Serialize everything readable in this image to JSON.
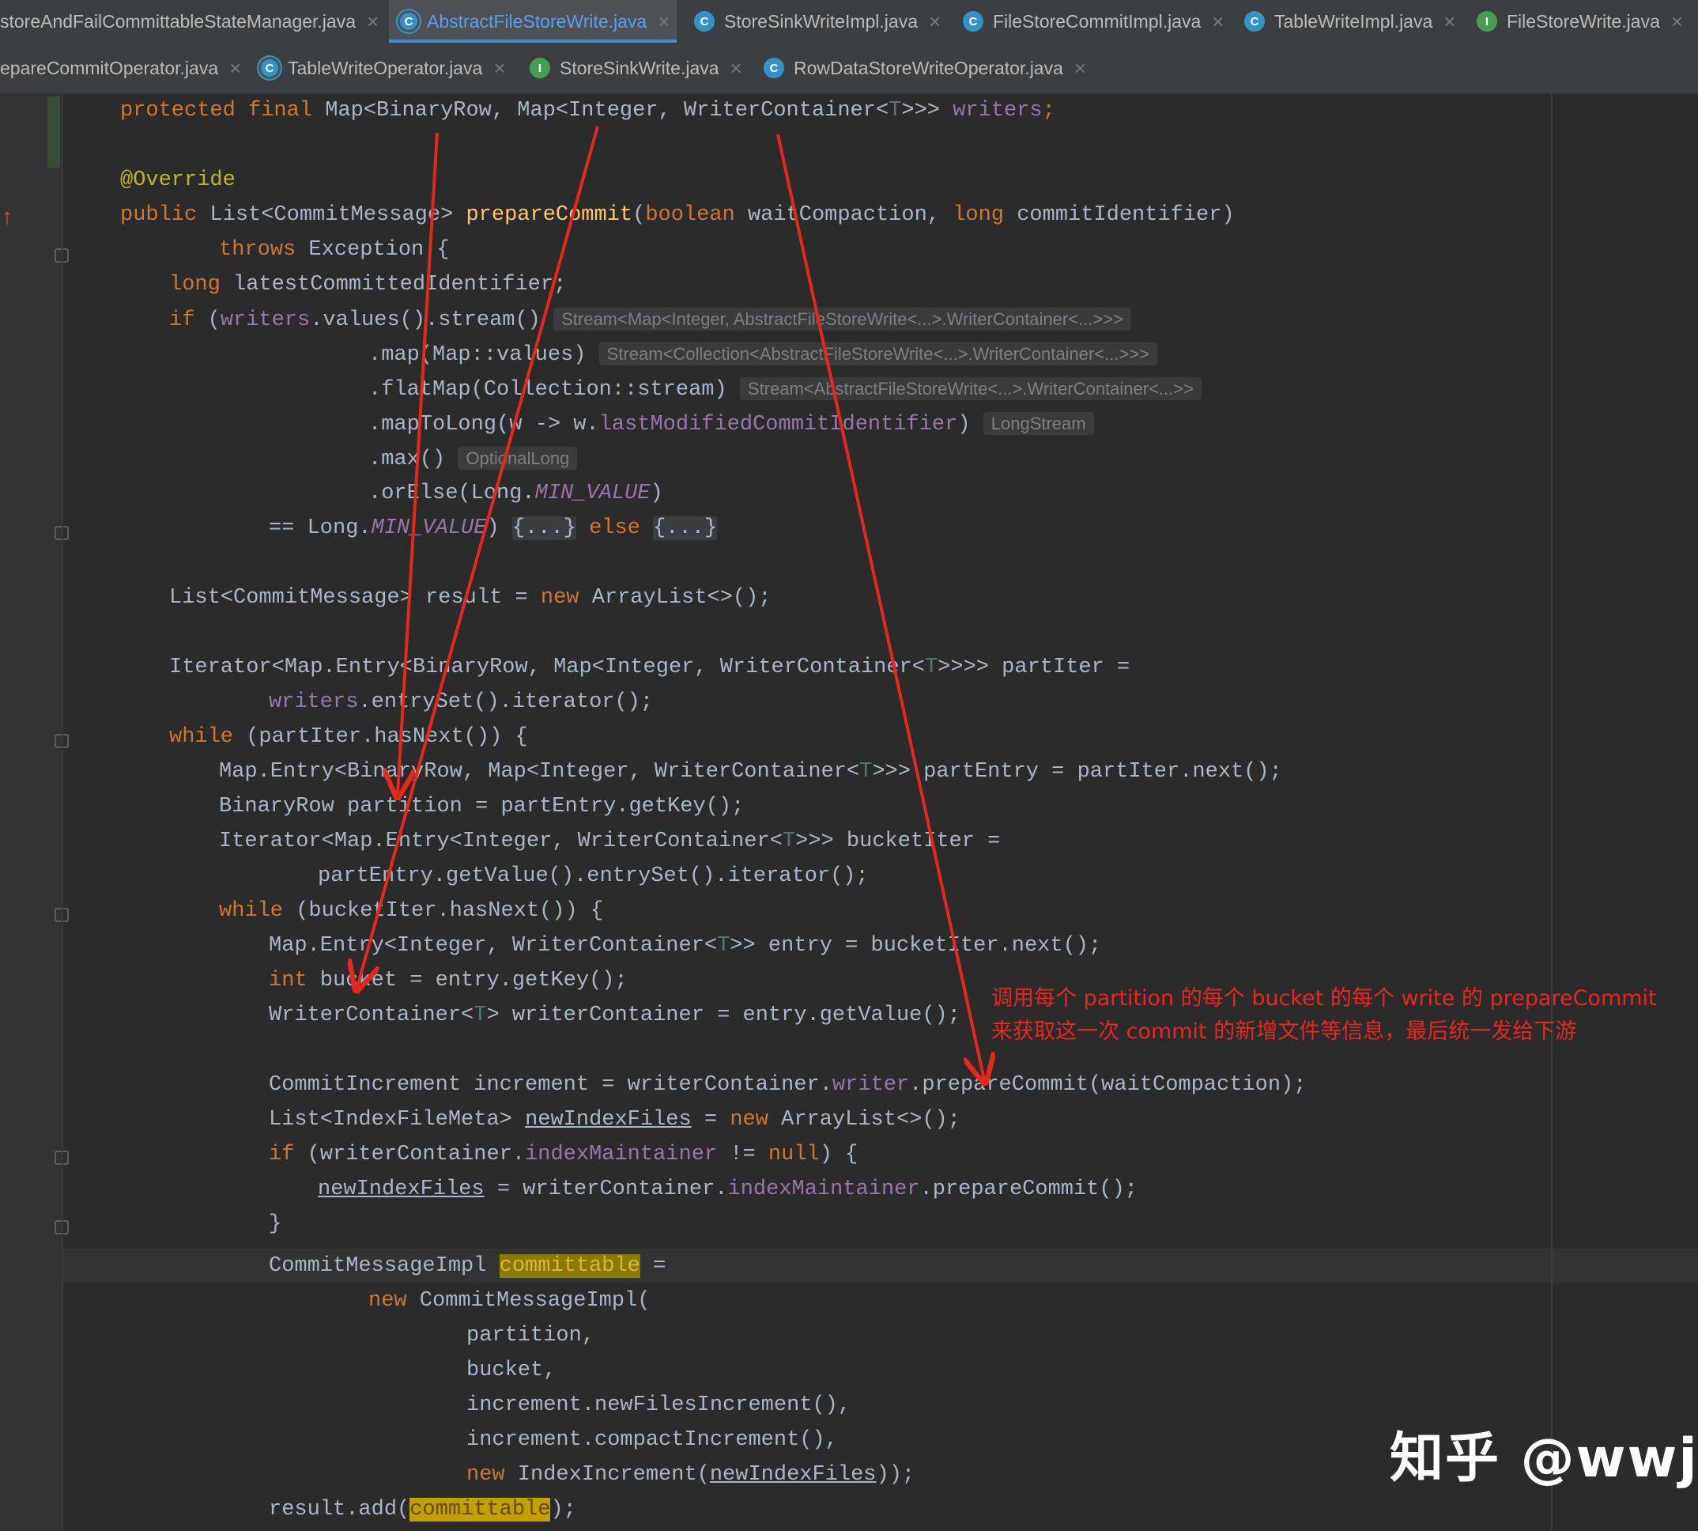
{
  "tabs_row1": [
    {
      "label": "storeAndFailCommittableStateManager.java",
      "icon": "none",
      "active": false
    },
    {
      "label": "AbstractFileStoreWrite.java",
      "icon": "abstract-class-icon",
      "active": true
    },
    {
      "label": "StoreSinkWriteImpl.java",
      "icon": "class-icon",
      "active": false
    },
    {
      "label": "FileStoreCommitImpl.java",
      "icon": "class-icon",
      "active": false
    },
    {
      "label": "TableWriteImpl.java",
      "icon": "class-icon",
      "active": false
    },
    {
      "label": "FileStoreWrite.java",
      "icon": "interface-icon",
      "active": false
    }
  ],
  "tabs_row2": [
    {
      "label": "epareCommitOperator.java",
      "icon": "none",
      "active": false
    },
    {
      "label": "TableWriteOperator.java",
      "icon": "abstract-class-icon",
      "active": false
    },
    {
      "label": "StoreSinkWrite.java",
      "icon": "interface-icon",
      "active": false
    },
    {
      "label": "RowDataStoreWriteOperator.java",
      "icon": "class-icon",
      "active": false
    }
  ],
  "icon_letters": {
    "class": "C",
    "interface": "I"
  },
  "close_glyph": "×",
  "code": {
    "l01": {
      "a": "protected final",
      "b": " Map<BinaryRow, Map<Integer, WriterContainer<",
      "t": "T",
      "c": ">>> ",
      "d": "writers",
      "e": ";"
    },
    "l02": {
      "a": "@Override"
    },
    "l03": {
      "a": "public",
      "b": " List<CommitMessage> ",
      "c": "prepareCommit",
      "d": "(",
      "e": "boolean",
      "f": " waitCompaction, ",
      "g": "long",
      "h": " commitIdentifier)"
    },
    "l04": {
      "a": "throws",
      "b": " Exception {"
    },
    "l05": {
      "a": "long",
      "b": " latestCommittedIdentifier;"
    },
    "l06": {
      "a": "if",
      "b": " (",
      "c": "writers",
      "d": ".values().stream() ",
      "hint": "Stream<Map<Integer, AbstractFileStoreWrite<...>.WriterContainer<...>>>"
    },
    "l07": {
      "a": ".map(Map::values) ",
      "hint": "Stream<Collection<AbstractFileStoreWrite<...>.WriterContainer<...>>>"
    },
    "l08": {
      "a": ".flatMap(Collection::stream) ",
      "hint": "Stream<AbstractFileStoreWrite<...>.WriterContainer<...>>"
    },
    "l09": {
      "a": ".mapToLong(w -> w.",
      "b": "lastModifiedCommitIdentifier",
      "c": ") ",
      "hint": "LongStream"
    },
    "l10": {
      "a": ".max() ",
      "hint": "OptionalLong"
    },
    "l11": {
      "a": ".orElse(Long.",
      "b": "MIN_VALUE",
      "c": ")"
    },
    "l12": {
      "a": "== Long.",
      "b": "MIN_VALUE",
      "c": ") ",
      "d": "{...}",
      "e": " else ",
      "f": "{...}"
    },
    "l13": {
      "a": "List<CommitMessage> result = ",
      "b": "new",
      "c": " ArrayList<>();"
    },
    "l14": {
      "a": "Iterator<Map.Entry<BinaryRow, Map<Integer, WriterContainer<",
      "t": "T",
      "b": ">>>> partIter ="
    },
    "l15": {
      "a": "writers",
      "b": ".entrySet().iterator();"
    },
    "l16": {
      "a": "while",
      "b": " (partIter.hasNext()) {"
    },
    "l17": {
      "a": "Map.Entry<BinaryRow, Map<Integer, WriterContainer<",
      "t": "T",
      "b": ">>> partEntry = partIter.next();"
    },
    "l18": {
      "a": "BinaryRow partition = partEntry.getKey();"
    },
    "l19": {
      "a": "Iterator<Map.Entry<Integer, WriterContainer<",
      "t": "T",
      "b": ">>> bucketIter ="
    },
    "l20": {
      "a": "partEntry.getValue().entrySet().iterator();"
    },
    "l21": {
      "a": "while",
      "b": " (bucketIter.hasNext()) {"
    },
    "l22": {
      "a": "Map.Entry<Integer, WriterContainer<",
      "t": "T",
      "b": ">> entry = bucketIter.next();"
    },
    "l23": {
      "a": "int",
      "b": " bucket = entry.getKey();"
    },
    "l24": {
      "a": "WriterContainer<",
      "t": "T",
      "b": "> writerContainer = entry.getValue();"
    },
    "l25": {
      "a": "CommitIncrement increment = writerContainer.",
      "b": "writer",
      "c": ".prepareCommit(waitCompaction);"
    },
    "l26": {
      "a": "List<IndexFileMeta> ",
      "b": "newIndexFiles",
      "c": " = ",
      "d": "new",
      "e": " ArrayList<>();"
    },
    "l27": {
      "a": "if",
      "b": " (writerContainer.",
      "c": "indexMaintainer",
      "d": " != ",
      "e": "null",
      "f": ") {"
    },
    "l28": {
      "a": "newIndexFiles",
      "b": " = writerContainer.",
      "c": "indexMaintainer",
      "d": ".prepareCommit();"
    },
    "l29": {
      "a": "}"
    },
    "l30": {
      "a": "CommitMessageImpl ",
      "b": "committable",
      "c": " ="
    },
    "l31": {
      "a": "new",
      "b": " CommitMessageImpl("
    },
    "l32": {
      "a": "partition,"
    },
    "l33": {
      "a": "bucket,"
    },
    "l34": {
      "a": "increment.newFilesIncrement(),"
    },
    "l35": {
      "a": "increment.compactIncrement(),"
    },
    "l36": {
      "a": "new",
      "b": " IndexIncrement(",
      "c": "newIndexFiles",
      "d": "));"
    },
    "l37": {
      "a": "result.add(",
      "b": "committable",
      "c": ");"
    }
  },
  "annotation_note": {
    "line1": "调用每个 partition 的每个 bucket 的每个 write 的 prepareCommit",
    "line2": "来获取这一次 commit 的新增文件等信息，最后统一发给下游"
  },
  "watermark": "知乎 @wwj",
  "colors": {
    "arrow": "#e3281f",
    "keyword": "#cc7832",
    "method": "#ffc66d",
    "field": "#9876aa",
    "highlight": "#8a7a00"
  }
}
